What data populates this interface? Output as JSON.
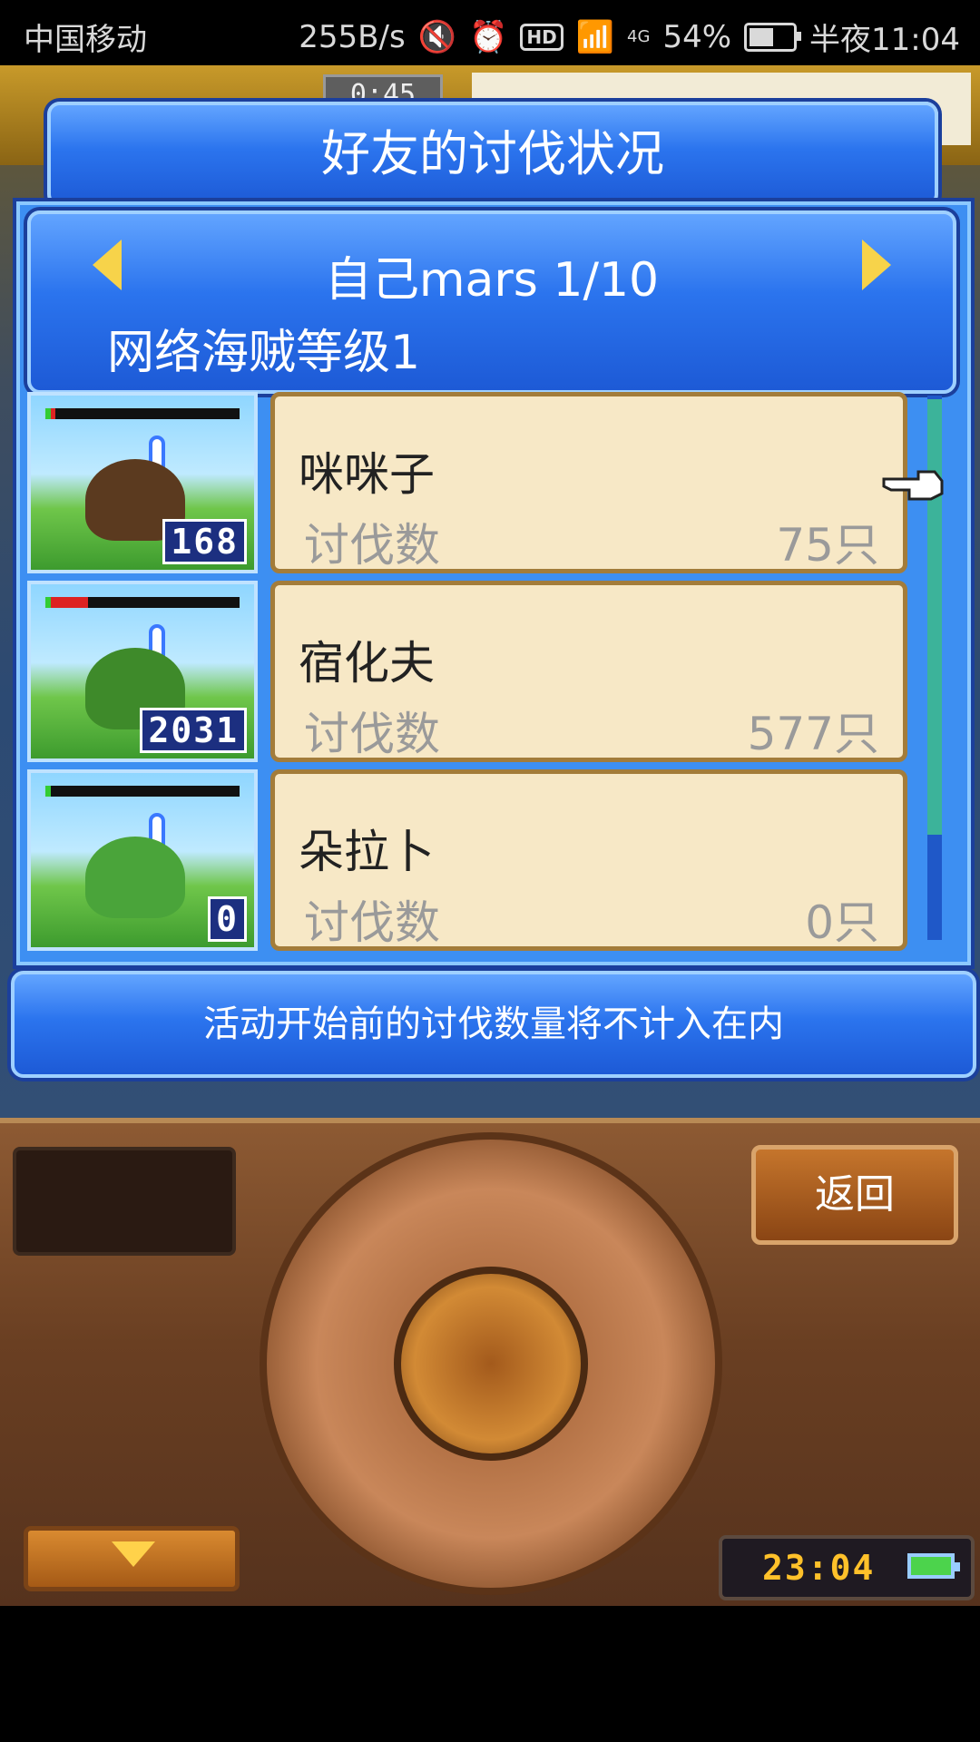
{
  "status_bar": {
    "carrier": "中国移动",
    "net_speed": "255B/s",
    "hd": "HD",
    "network": "4G",
    "battery_percent": "54%",
    "time": "半夜11:04"
  },
  "hud": {
    "timer": "0:45"
  },
  "dialog": {
    "title": "好友的讨伐状况",
    "player_name": "自己mars 1/10",
    "pirate_level": "网络海贼等级1",
    "friends": [
      {
        "name": "咪咪子",
        "kill_label": "讨伐数",
        "kill_value": "75只",
        "count": "168",
        "hp": 0.05,
        "color": "#5b3a1f"
      },
      {
        "name": "宿化夫",
        "kill_label": "讨伐数",
        "kill_value": "577只",
        "count": "2031",
        "hp": 0.22,
        "color": "#3e8a2a"
      },
      {
        "name": "朵拉卜",
        "kill_label": "讨伐数",
        "kill_value": "0只",
        "count": "0",
        "hp": 0.0,
        "color": "#4aa43a"
      }
    ],
    "notice": "活动开始前的讨伐数量将不计入在内"
  },
  "console": {
    "back_label": "返回",
    "clock": "23:04"
  }
}
